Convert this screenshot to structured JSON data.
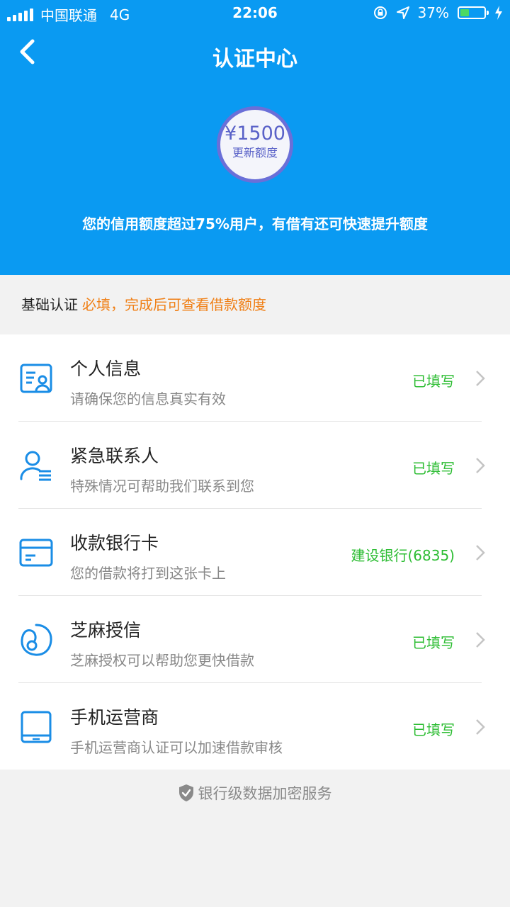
{
  "status_bar": {
    "carrier": "中国联通",
    "network": "4G",
    "time": "22:06",
    "battery": "37%",
    "battery_level": 0.37
  },
  "header": {
    "title": "认证中心",
    "back_icon": "chevron-left-icon"
  },
  "credit": {
    "amount": "¥1500",
    "update_label": "更新额度",
    "note": "您的信用额度超过75%用户，有借有还可快速提升额度"
  },
  "section": {
    "title": "基础认证",
    "hint": "必填，完成后可查看借款额度"
  },
  "items": [
    {
      "icon": "id-card-icon",
      "name": "个人信息",
      "desc": "请确保您的信息真实有效",
      "status": "已填写"
    },
    {
      "icon": "contact-person-icon",
      "name": "紧急联系人",
      "desc": "特殊情况可帮助我们联系到您",
      "status": "已填写"
    },
    {
      "icon": "bank-card-icon",
      "name": "收款银行卡",
      "desc": "您的借款将打到这张卡上",
      "status": "建设银行(6835)"
    },
    {
      "icon": "sesame-icon",
      "name": "芝麻授信",
      "desc": "芝麻授权可以帮助您更快借款",
      "status": "已填写"
    },
    {
      "icon": "tablet-icon",
      "name": "手机运营商",
      "desc": "手机运营商认证可以加速借款审核",
      "status": "已填写"
    }
  ],
  "footer": {
    "text": "银行级数据加密服务",
    "icon": "shield-check-icon"
  },
  "colors": {
    "brand_blue": "#0a9af2",
    "icon_blue": "#1a8de6",
    "status_green": "#2dbd33",
    "hint_orange": "#f07f15"
  }
}
